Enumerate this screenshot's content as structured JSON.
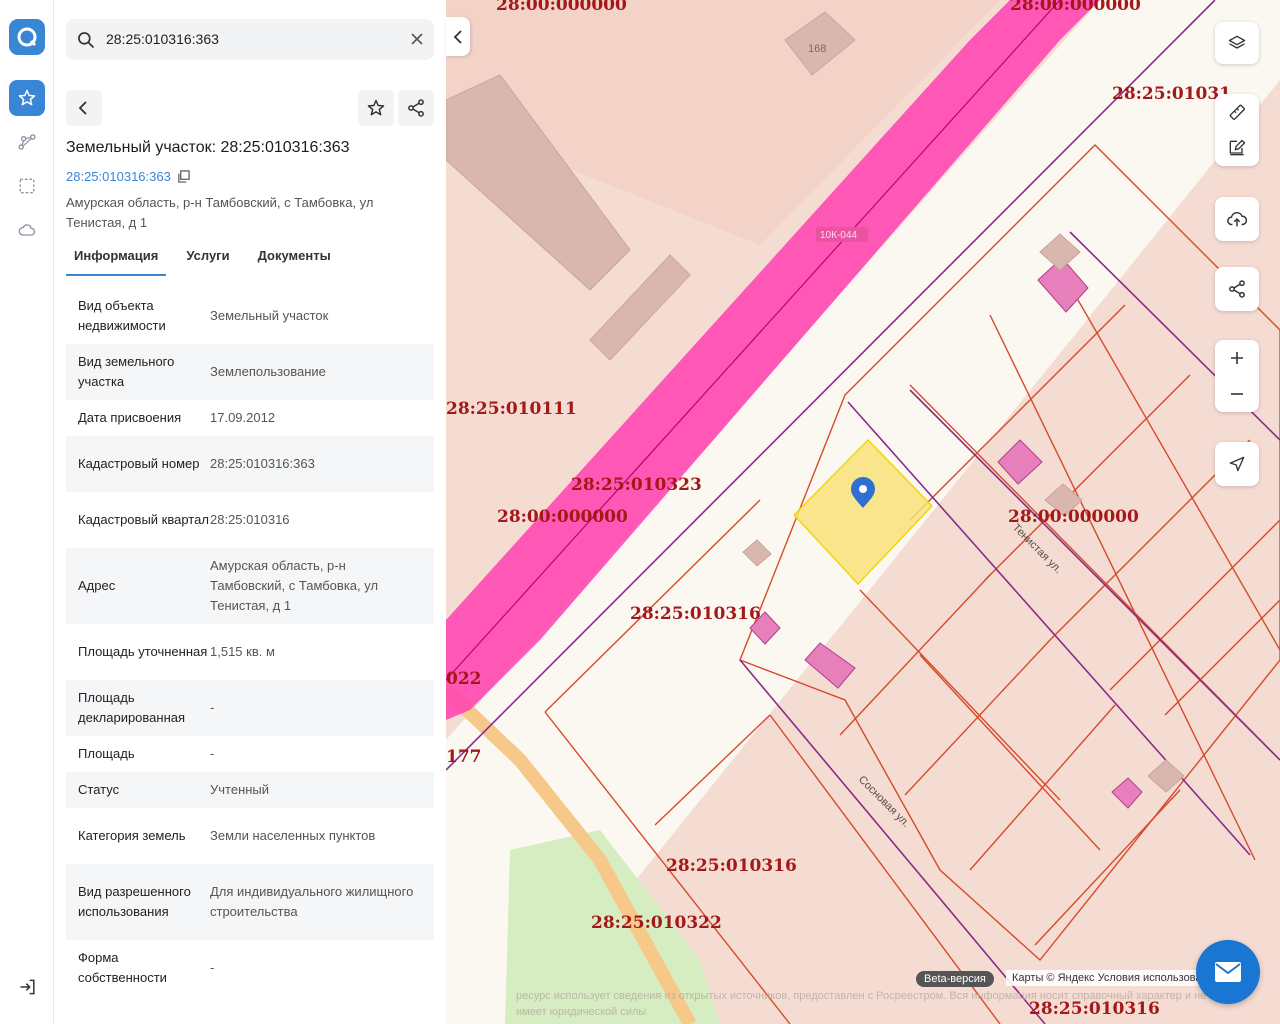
{
  "search": {
    "query": "28:25:010316:363"
  },
  "parcel": {
    "title": "Земельный участок: 28:25:010316:363",
    "cadastral_link": "28:25:010316:363",
    "address": "Амурская область, р-н Тамбовский, с Тамбовка, ул Тенистая, д 1"
  },
  "tabs": [
    "Информация",
    "Услуги",
    "Документы"
  ],
  "info_rows": [
    {
      "key": "Вид объекта недвижимости",
      "value": "Земельный участок"
    },
    {
      "key": "Вид земельного участка",
      "value": "Землепользование"
    },
    {
      "key": "Дата присвоения",
      "value": "17.09.2012"
    },
    {
      "key": "Кадастровый номер",
      "value": "28:25:010316:363"
    },
    {
      "key": "Кадастровый квартал",
      "value": "28:25:010316"
    },
    {
      "key": "Адрес",
      "value": "Амурская область, р-н Тамбовский, с Тамбовка, ул Тенистая, д 1"
    },
    {
      "key": "Площадь уточненная",
      "value": "1,515 кв. м"
    },
    {
      "key": "Площадь декларированная",
      "value": "-"
    },
    {
      "key": "Площадь",
      "value": "-"
    },
    {
      "key": "Статус",
      "value": "Учтенный"
    },
    {
      "key": "Категория земель",
      "value": "Земли населенных пунктов"
    },
    {
      "key": "Вид разрешенного использования",
      "value": "Для индивидуального жилищного строительства"
    },
    {
      "key": "Форма собственности",
      "value": "-"
    }
  ],
  "map": {
    "labels": {
      "q_top1": "28:00:000000",
      "q_top2": "28:00:000000",
      "q_topright": "28:25:01031",
      "q_010111": "28:25:010111",
      "q_010323": "28:25:010323",
      "q_left": "28:00:000000",
      "q_right": "28:00:000000",
      "q_010316a": "28:25:010316",
      "q_010316b": "28:25:010316",
      "q_010322": "28:25:010322",
      "q_bottomright": "28:25:010316",
      "q_022": "022",
      "q_177": "177",
      "house_168": "168",
      "road": "10К-044",
      "street1": "Тенистая ул.",
      "street2": "Сосновая ул."
    },
    "beta": "Beta-версия",
    "attribution": "Карты © Яндекс   Условия использования",
    "disclaimer": "ресурс использует сведения из открытых источников, предоставлен с Росреестром. Вся информация носит справочный характер и не имеет юридической силы"
  },
  "colors": {
    "accent": "#3a86d6",
    "parcel_fill": "#f7e27a",
    "road_pink": "#ff3fb0",
    "boundary": "#d64a2a"
  }
}
